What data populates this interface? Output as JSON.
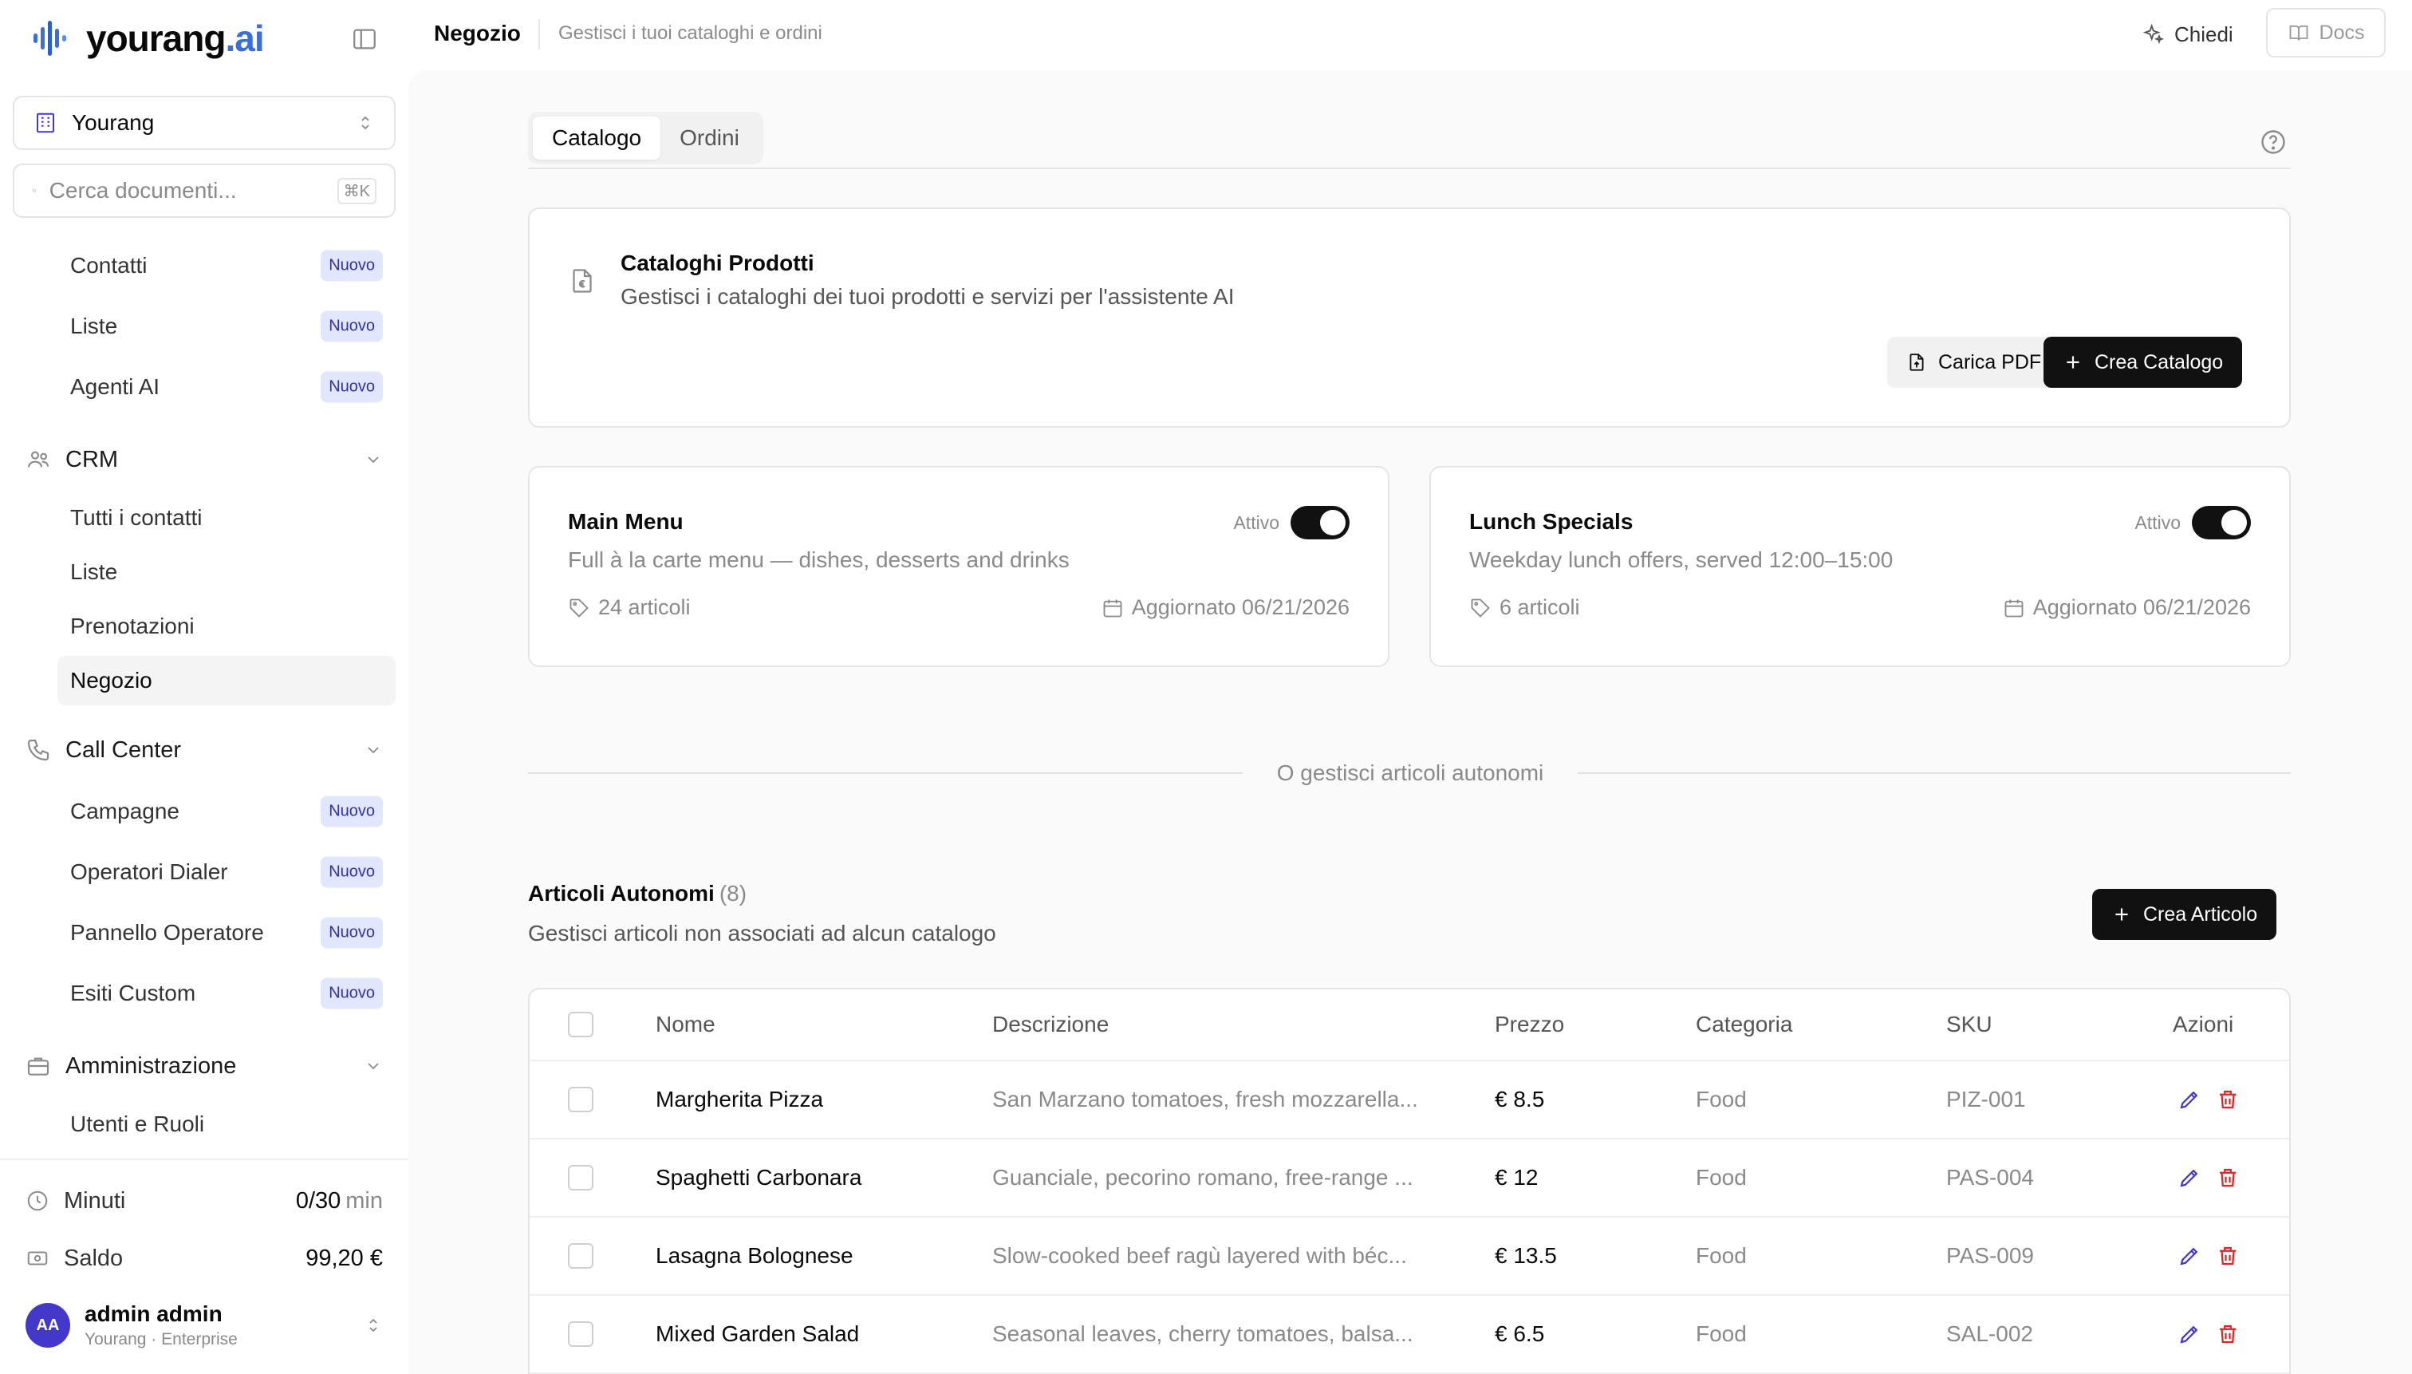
{
  "brand": {
    "name": "yourang",
    "suffix": ".ai",
    "accent": "#3b6fd6"
  },
  "sidebar": {
    "workspace": "Yourang",
    "search_placeholder": "Cerca documenti...",
    "search_shortcut": "⌘K",
    "top_items": [
      {
        "label": "Contatti",
        "badge": "Nuovo"
      },
      {
        "label": "Liste",
        "badge": "Nuovo"
      },
      {
        "label": "Agenti AI",
        "badge": "Nuovo"
      }
    ],
    "crm": {
      "label": "CRM",
      "items": [
        "Tutti i contatti",
        "Liste",
        "Prenotazioni",
        "Negozio"
      ]
    },
    "call_center": {
      "label": "Call Center",
      "items": [
        {
          "label": "Campagne",
          "badge": "Nuovo"
        },
        {
          "label": "Operatori Dialer",
          "badge": "Nuovo"
        },
        {
          "label": "Pannello Operatore",
          "badge": "Nuovo"
        },
        {
          "label": "Esiti Custom",
          "badge": "Nuovo"
        }
      ]
    },
    "admin": {
      "label": "Amministrazione",
      "items": [
        "Utenti e Ruoli"
      ]
    },
    "usage": {
      "minutes_label": "Minuti",
      "minutes_value": "0/30",
      "minutes_unit": "min",
      "balance_label": "Saldo",
      "balance_value": "99,20 €"
    },
    "user": {
      "initials": "AA",
      "name": "admin admin",
      "subtitle": "Yourang · Enterprise"
    }
  },
  "topbar": {
    "title": "Negozio",
    "subtitle": "Gestisci i tuoi cataloghi e ordini",
    "ask_label": "Chiedi",
    "docs_label": "Docs"
  },
  "tabs": [
    "Catalogo",
    "Ordini"
  ],
  "catalogs_header": {
    "title": "Cataloghi Prodotti",
    "description": "Gestisci i cataloghi dei tuoi prodotti e servizi per l'assistente AI",
    "upload_label": "Carica PDF",
    "create_label": "Crea Catalogo"
  },
  "catalogs": [
    {
      "title": "Main Menu",
      "description": "Full à la carte menu — dishes, desserts and drinks",
      "status": "Attivo",
      "active": true,
      "items": "24 articoli",
      "updated": "Aggiornato 06/21/2026"
    },
    {
      "title": "Lunch Specials",
      "description": "Weekday lunch offers, served 12:00–15:00",
      "status": "Attivo",
      "active": true,
      "items": "6 articoli",
      "updated": "Aggiornato 06/21/2026"
    }
  ],
  "divider_label": "O gestisci articoli autonomi",
  "standalone": {
    "title": "Articoli Autonomi",
    "count": "(8)",
    "description": "Gestisci articoli non associati ad alcun catalogo",
    "create_label": "Crea Articolo",
    "columns": [
      "Nome",
      "Descrizione",
      "Prezzo",
      "Categoria",
      "SKU",
      "Azioni"
    ],
    "rows": [
      {
        "name": "Margherita Pizza",
        "description": "San Marzano tomatoes, fresh mozzarella...",
        "price": "€ 8.5",
        "category": "Food",
        "sku": "PIZ-001"
      },
      {
        "name": "Spaghetti Carbonara",
        "description": "Guanciale, pecorino romano, free-range ...",
        "price": "€ 12",
        "category": "Food",
        "sku": "PAS-004"
      },
      {
        "name": "Lasagna Bolognese",
        "description": "Slow-cooked beef ragù layered with béc...",
        "price": "€ 13.5",
        "category": "Food",
        "sku": "PAS-009"
      },
      {
        "name": "Mixed Garden Salad",
        "description": "Seasonal leaves, cherry tomatoes, balsa...",
        "price": "€ 6.5",
        "category": "Food",
        "sku": "SAL-002"
      }
    ]
  },
  "colors": {
    "badge_bg": "#e0e7ff",
    "badge_text": "#3730a3",
    "edit": "#4338ca",
    "delete": "#dc2626",
    "primary": "#111111"
  }
}
